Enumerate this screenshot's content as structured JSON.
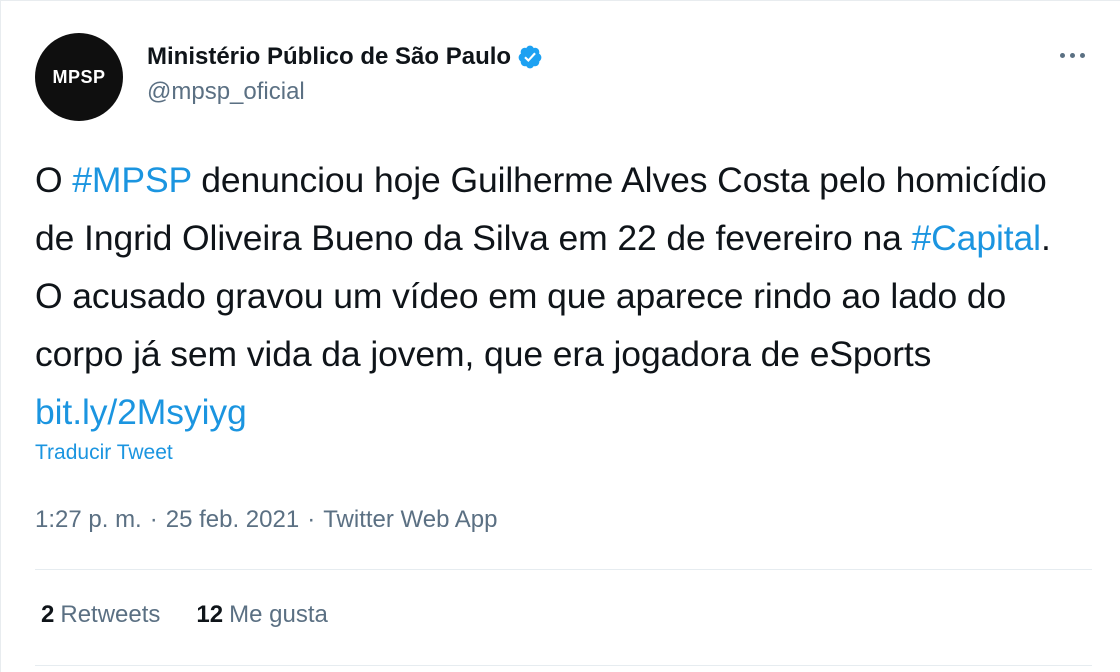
{
  "author": {
    "avatar_text": "MPSP",
    "display_name": "Ministério Público de São Paulo",
    "handle": "@mpsp_oficial",
    "verified": true,
    "verified_icon": "verified-badge-icon",
    "verified_color": "#1da1f2"
  },
  "menu": {
    "icon": "more-options-icon"
  },
  "tweet": {
    "segments": [
      {
        "text": "O ",
        "type": "text"
      },
      {
        "text": "#MPSP",
        "type": "hashtag"
      },
      {
        "text": " denunciou hoje Guilherme Alves Costa pelo homicídio de Ingrid Oliveira Bueno da Silva em 22 de fevereiro na ",
        "type": "text"
      },
      {
        "text": "#Capital",
        "type": "hashtag"
      },
      {
        "text": ". O acusado gravou um vídeo em que aparece rindo ao lado do corpo já sem vida da jovem, que era jogadora de eSports ",
        "type": "text"
      },
      {
        "text": "bit.ly/2Msyiyg",
        "type": "url"
      }
    ],
    "translate_label": "Traducir Tweet"
  },
  "meta": {
    "time": "1:27 p. m.",
    "separator": "·",
    "date": "25 feb. 2021",
    "source": "Twitter Web App"
  },
  "stats": {
    "retweets_count": "2",
    "retweets_label": "Retweets",
    "likes_count": "12",
    "likes_label": "Me gusta"
  },
  "colors": {
    "link": "#1b95e0",
    "text": "#0f1419",
    "secondary": "#5b7083",
    "avatar_bg": "#0f0f0f"
  }
}
